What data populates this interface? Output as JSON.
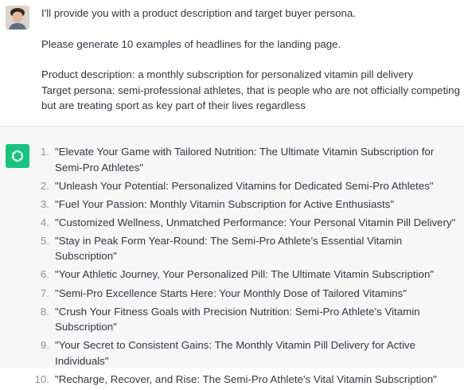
{
  "user_message": {
    "avatar_alt": "user-avatar",
    "paragraphs": [
      "I'll provide you with a product description and target buyer persona.",
      "Please generate 10 examples of headlines for the landing page.",
      "Product description: a monthly subscription for personalized vitamin pill delivery",
      "Target persona: semi-professional athletes, that is people who are not officially competing but are treating sport as key part of their lives regardless"
    ]
  },
  "assistant_message": {
    "avatar_color": "#19c37d",
    "items": [
      {
        "num": "1.",
        "text": "\"Elevate Your Game with Tailored Nutrition: The Ultimate Vitamin Subscription for Semi-Pro Athletes\""
      },
      {
        "num": "2.",
        "text": "\"Unleash Your Potential: Personalized Vitamins for Dedicated Semi-Pro Athletes\""
      },
      {
        "num": "3.",
        "text": "\"Fuel Your Passion: Monthly Vitamin Subscription for Active Enthusiasts\""
      },
      {
        "num": "4.",
        "text": "\"Customized Wellness, Unmatched Performance: Your Personal Vitamin Pill Delivery\""
      },
      {
        "num": "5.",
        "text": "\"Stay in Peak Form Year-Round: The Semi-Pro Athlete's Essential Vitamin Subscription\""
      },
      {
        "num": "6.",
        "text": "\"Your Athletic Journey, Your Personalized Pill: The Ultimate Vitamin Subscription\""
      },
      {
        "num": "7.",
        "text": "\"Semi-Pro Excellence Starts Here: Your Monthly Dose of Tailored Vitamins\""
      },
      {
        "num": "8.",
        "text": "\"Crush Your Fitness Goals with Precision Nutrition: Semi-Pro Athlete's Vitamin Subscription\""
      },
      {
        "num": "9.",
        "text": "\"Your Secret to Consistent Gains: The Monthly Vitamin Pill Delivery for Active Individuals\""
      },
      {
        "num": "10.",
        "text": "\"Recharge, Recover, and Rise: The Semi-Pro Athlete's Vital Vitamin Subscription\""
      }
    ]
  }
}
